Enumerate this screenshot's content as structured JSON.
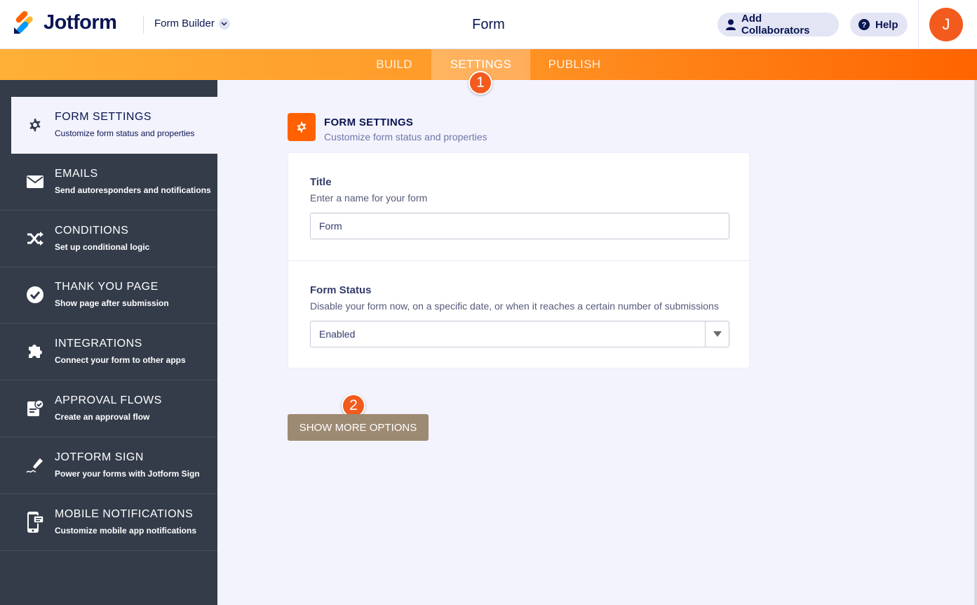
{
  "header": {
    "logo_text": "Jotform",
    "builder_label": "Form Builder",
    "form_title": "Form",
    "collaborators_label": "Add Collaborators",
    "help_label": "Help",
    "avatar_initial": "J"
  },
  "nav": {
    "tabs": [
      {
        "label": "BUILD"
      },
      {
        "label": "SETTINGS"
      },
      {
        "label": "PUBLISH"
      }
    ],
    "active_tab": "SETTINGS"
  },
  "annotations": {
    "step1": "1",
    "step2": "2"
  },
  "sidebar": {
    "items": [
      {
        "title": "FORM SETTINGS",
        "subtitle": "Customize form status and properties",
        "icon": "gear-icon"
      },
      {
        "title": "EMAILS",
        "subtitle": "Send autoresponders and notifications",
        "icon": "envelope-icon"
      },
      {
        "title": "CONDITIONS",
        "subtitle": "Set up conditional logic",
        "icon": "shuffle-icon"
      },
      {
        "title": "THANK YOU PAGE",
        "subtitle": "Show page after submission",
        "icon": "check-circle-icon"
      },
      {
        "title": "INTEGRATIONS",
        "subtitle": "Connect your form to other apps",
        "icon": "puzzle-icon"
      },
      {
        "title": "APPROVAL FLOWS",
        "subtitle": "Create an approval flow",
        "icon": "approval-doc-icon"
      },
      {
        "title": "JOTFORM SIGN",
        "subtitle": "Power your forms with Jotform Sign",
        "icon": "pen-sign-icon"
      },
      {
        "title": "MOBILE NOTIFICATIONS",
        "subtitle": "Customize mobile app notifications",
        "icon": "mobile-notification-icon"
      }
    ]
  },
  "main": {
    "section_title": "FORM SETTINGS",
    "section_subtitle": "Customize form status and properties",
    "title_field": {
      "label": "Title",
      "help": "Enter a name for your form",
      "value": "Form"
    },
    "status_field": {
      "label": "Form Status",
      "help": "Disable your form now, on a specific date, or when it reaches a certain number of submissions",
      "value": "Enabled"
    },
    "show_more_label": "SHOW MORE OPTIONS"
  },
  "colors": {
    "accent": "#ff6100",
    "sidebar_bg": "#343c4a",
    "main_bg": "#f3f3fe",
    "show_more_bg": "#9d8a72"
  }
}
